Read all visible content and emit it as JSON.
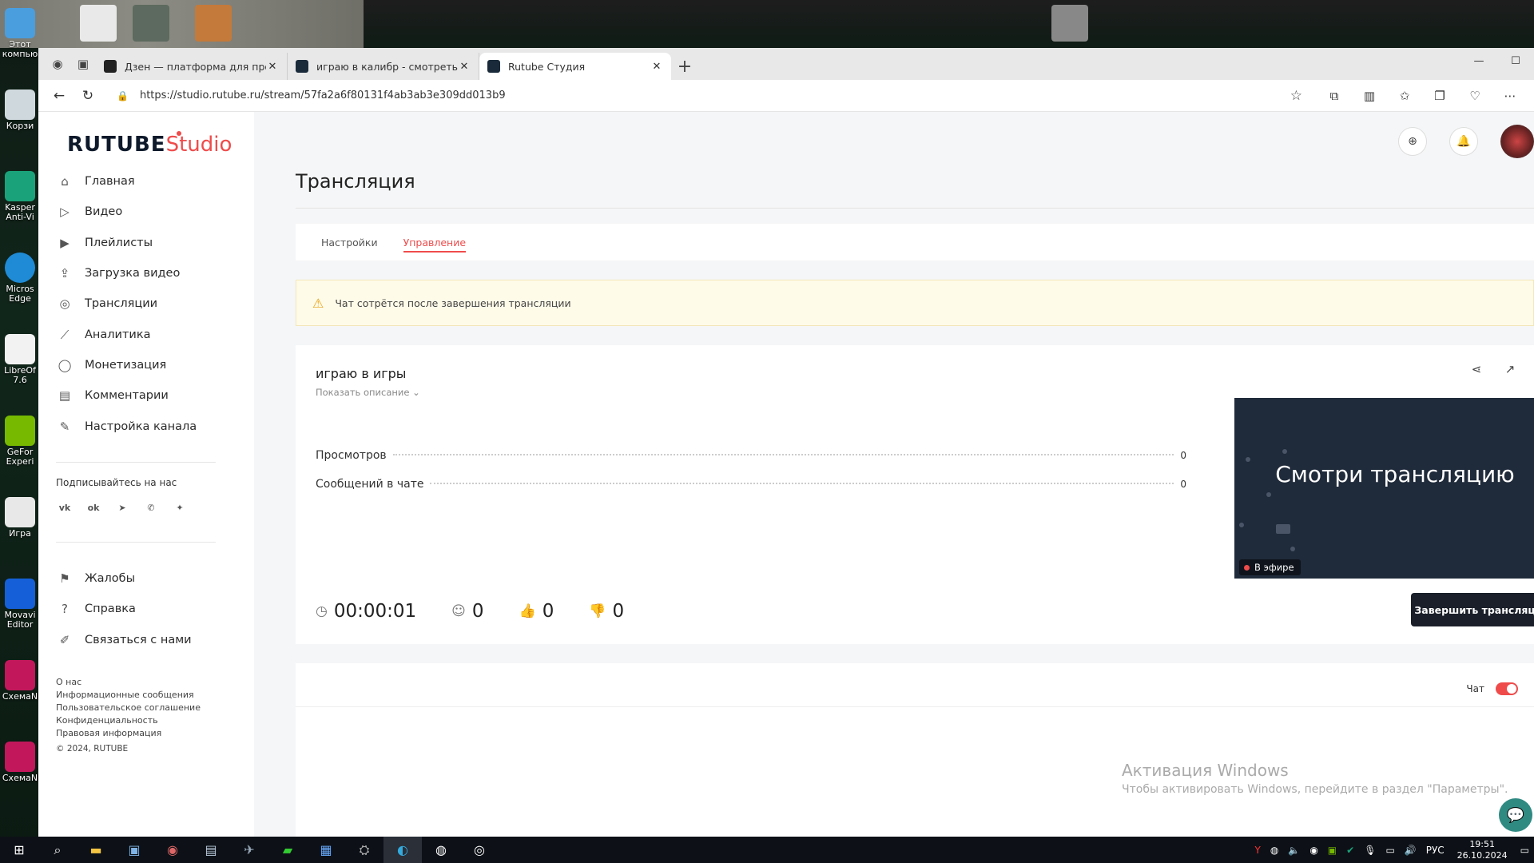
{
  "desktop": {
    "icons": [
      {
        "label": "Этот компью",
        "color": "#4a9ede"
      },
      {
        "label": "Корзи",
        "color": "#cfd8dc"
      },
      {
        "label": "Kasper Anti-Vi",
        "color": "#1aa37a"
      },
      {
        "label": "Micros Edge",
        "color": "#1f8bd6"
      },
      {
        "label": "LibreOf 7.6",
        "color": "#f2f2f2"
      },
      {
        "label": "GeFor Experi",
        "color": "#76b900"
      },
      {
        "label": "Игра",
        "color": "#e8e8e8"
      },
      {
        "label": "Movavi Editor",
        "color": "#1560d8"
      },
      {
        "label": "СхемаN",
        "color": "#c2185b"
      },
      {
        "label": "СхемаN",
        "color": "#c2185b"
      }
    ]
  },
  "browser": {
    "tabs": [
      {
        "title": "Дзен — платформа для просмотр",
        "favicon_color": "#222222",
        "active": false
      },
      {
        "title": "играю в калибр - смотреть виде",
        "favicon_color": "#1a2a3a",
        "active": false
      },
      {
        "title": "Rutube Студия",
        "favicon_color": "#1a2a3a",
        "active": true
      }
    ],
    "new_tab_symbol": "+",
    "url": "https://studio.rutube.ru/stream/57fa2a6f80131f4ab3ab3e309dd013b9"
  },
  "studio": {
    "logo_main": "RUTUBE",
    "logo_sub": "Studio",
    "brand_color": "#ef4b4b",
    "menu": [
      {
        "label": "Главная",
        "icon": "home-icon"
      },
      {
        "label": "Видео",
        "icon": "video-icon"
      },
      {
        "label": "Плейлисты",
        "icon": "playlist-icon"
      },
      {
        "label": "Загрузка видео",
        "icon": "upload-icon"
      },
      {
        "label": "Трансляции",
        "icon": "broadcast-icon"
      },
      {
        "label": "Аналитика",
        "icon": "analytics-icon"
      },
      {
        "label": "Монетизация",
        "icon": "money-icon"
      },
      {
        "label": "Комментарии",
        "icon": "comments-icon"
      },
      {
        "label": "Настройка канала",
        "icon": "wand-icon"
      }
    ],
    "follow_label": "Подписывайтесь на нас",
    "menu_secondary": [
      {
        "label": "Жалобы",
        "icon": "flag-icon"
      },
      {
        "label": "Справка",
        "icon": "help-icon"
      },
      {
        "label": "Связаться с нами",
        "icon": "pen-icon"
      }
    ],
    "footer_links": [
      "О нас",
      "Информационные сообщения",
      "Пользовательское соглашение",
      "Конфиденциальность",
      "Правовая информация"
    ],
    "copyright": "© 2024, RUTUBE",
    "page_title": "Трансляция",
    "page_tabs": [
      {
        "label": "Настройки",
        "active": false
      },
      {
        "label": "Управление",
        "active": true
      }
    ],
    "notice": "Чат сотрётся после завершения трансляции",
    "stream": {
      "title": "играю в игры",
      "show_description": "Показать описание",
      "stats": [
        {
          "label": "Просмотров",
          "value": "0"
        },
        {
          "label": "Сообщений в чате",
          "value": "0"
        }
      ],
      "preview_text": "Смотри трансляцию",
      "live_label": "В эфире",
      "duration": "00:00:01",
      "viewers": "0",
      "likes": "0",
      "dislikes": "0",
      "end_button": "Завершить трансляцию"
    },
    "chat_label": "Чат",
    "chat_enabled": true
  },
  "os": {
    "activation_title": "Активация Windows",
    "activation_text": "Чтобы активировать Windows, перейдите в раздел \"Параметры\".",
    "language": "РУС",
    "time": "19:51",
    "date": "26.10.2024"
  }
}
